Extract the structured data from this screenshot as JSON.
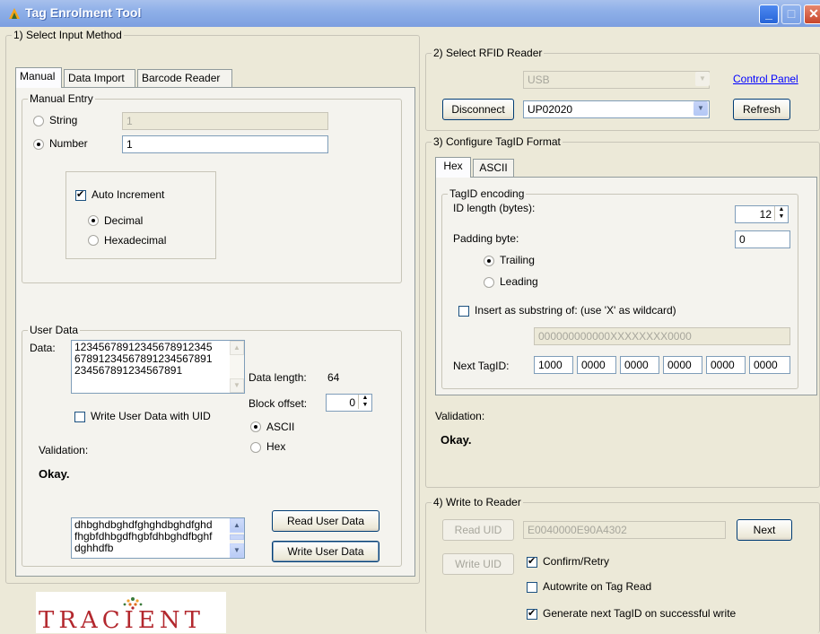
{
  "window": {
    "title": "Tag Enrolment Tool"
  },
  "section1": {
    "title": "1) Select Input Method",
    "tabs": [
      "Manual",
      "Data Import",
      "Barcode Reader"
    ],
    "manual_entry": {
      "title": "Manual Entry",
      "string_label": "String",
      "string_value": "1",
      "number_label": "Number",
      "number_value": "1",
      "auto_increment_label": "Auto Increment",
      "decimal_label": "Decimal",
      "hex_label": "Hexadecimal"
    },
    "user_data": {
      "title": "User Data",
      "data_label": "Data:",
      "data_lines": [
        "12345678912345678912345",
        "67891234567891234567891",
        "234567891234567891"
      ],
      "data_length_label": "Data length:",
      "data_length_value": "64",
      "block_offset_label": "Block offset:",
      "block_offset_value": "0",
      "write_with_uid_label": "Write User Data with UID",
      "ascii_label": "ASCII",
      "hex_label": "Hex",
      "validation_label": "Validation:",
      "validation_value": "Okay.",
      "read_lines": [
        "dhbghdbghdfghghdbghdfghd",
        "fhgbfdhbgdfhgbfdhbghdfbghf",
        "dghhdfb"
      ],
      "read_button": "Read User Data",
      "write_button": "Write User Data"
    }
  },
  "section2": {
    "title": "2) Select RFID Reader",
    "connection_value": "USB",
    "control_panel_link": "Control Panel",
    "disconnect_button": "Disconnect",
    "reader_value": "UP02020",
    "refresh_button": "Refresh"
  },
  "section3": {
    "title": "3) Configure TagID Format",
    "tabs": [
      "Hex",
      "ASCII"
    ],
    "encoding": {
      "title": "TagID encoding",
      "id_length_label": "ID length (bytes):",
      "id_length_value": "12",
      "padding_label": "Padding byte:",
      "padding_value": "0",
      "trailing_label": "Trailing",
      "leading_label": "Leading",
      "substring_label": "Insert as substring of: (use 'X' as wildcard)",
      "substring_value": "000000000000XXXXXXXX0000",
      "next_tagid_label": "Next TagID:",
      "next_tagid_values": [
        "1000",
        "0000",
        "0000",
        "0000",
        "0000",
        "0000"
      ]
    },
    "validation_label": "Validation:",
    "validation_value": "Okay."
  },
  "section4": {
    "title": "4) Write to Reader",
    "read_uid_button": "Read UID",
    "uid_value": "E0040000E90A4302",
    "next_button": "Next",
    "write_uid_button": "Write UID",
    "confirm_retry_label": "Confirm/Retry",
    "autowrite_label": "Autowrite on Tag Read",
    "generate_next_label": "Generate next TagID on successful write"
  },
  "logo": {
    "text": "TRACIENT"
  }
}
